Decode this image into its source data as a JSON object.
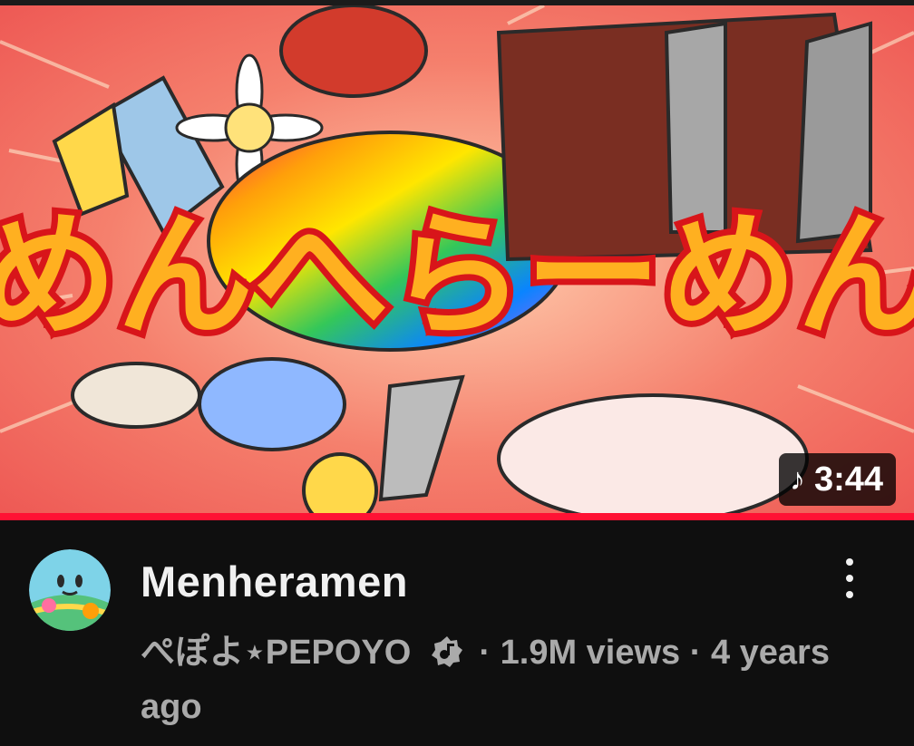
{
  "video": {
    "thumbnail_title": "めんへらーめん",
    "duration": "3:44",
    "duration_icon": "music-note-icon",
    "title": "Menheramen",
    "channel": "ぺぽよ⋆PEPOYO",
    "channel_badge": "verified-artist-icon",
    "meta_tail": "· 1.9M views · 4 years ago"
  },
  "menu": {
    "icon": "more-vertical-icon"
  },
  "colors": {
    "background": "#0f0f0f",
    "progress": "#ff1234",
    "primary_text": "#f1f1f1",
    "secondary_text": "#aaaaaa"
  }
}
